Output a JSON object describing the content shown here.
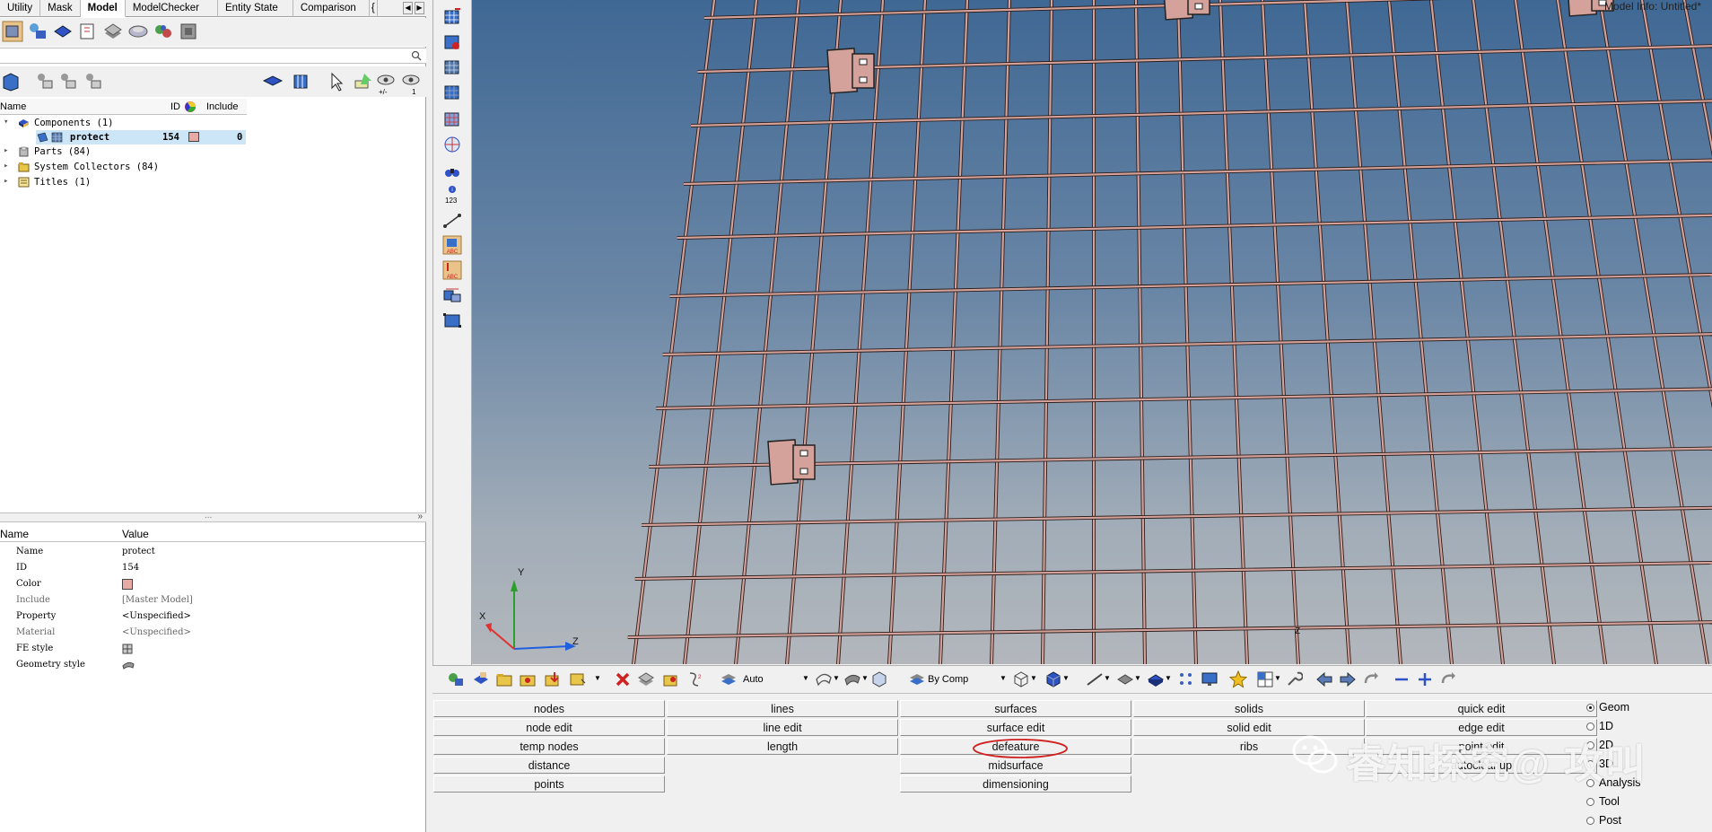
{
  "left_panel": {
    "tabs": [
      "Utility",
      "Mask",
      "Model",
      "ModelChecker",
      "Entity State",
      "Comparison",
      "{"
    ],
    "active_tab": "Model",
    "tab_scroll": {
      "left": "◀",
      "right": "▶"
    },
    "tree_header": {
      "name": "Name",
      "id": "ID",
      "include": "Include"
    },
    "tree": [
      {
        "label": "Components (1)",
        "icon": "components-icon"
      },
      {
        "label": "protect",
        "id": "154",
        "include": "0",
        "color": "#e8aaa4",
        "selected": true
      },
      {
        "label": "Parts (84)",
        "icon": "parts-icon"
      },
      {
        "label": "System Collectors (84)",
        "icon": "collectors-icon"
      },
      {
        "label": "Titles (1)",
        "icon": "titles-icon"
      }
    ],
    "splitter": {
      "dots": "...",
      "chevron": "»"
    },
    "props_header": {
      "name": "Name",
      "value": "Value"
    },
    "props": [
      {
        "key": "Name",
        "value": "protect"
      },
      {
        "key": "ID",
        "value": "154"
      },
      {
        "key": "Color",
        "value": "",
        "swatch": "#e8aaa4"
      },
      {
        "key": "Include",
        "value": "[Master Model]"
      },
      {
        "key": "Property",
        "value": "<Unspecified>"
      },
      {
        "key": "Material",
        "value": "<Unspecified>"
      },
      {
        "key": "FE style",
        "value": ""
      },
      {
        "key": "Geometry style",
        "value": ""
      }
    ],
    "toolbar2_labels": {
      "plus_minus": "+/-",
      "one": "1"
    }
  },
  "vertical_toolbar": {
    "info_label": "123"
  },
  "viewport": {
    "model_info": "Model Info: Untitled*",
    "triad": {
      "y": "Y",
      "x": "X",
      "z": "Z"
    },
    "small_triad_z": "Z",
    "background_top": "#3f6894",
    "background_bottom": "#b3b7bc",
    "mesh_color": "#d4a29a"
  },
  "bottom_toolbar": {
    "auto_label": "Auto",
    "bycomp_label": "By Comp"
  },
  "panel_menu": {
    "columns": [
      [
        "nodes",
        "node edit",
        "temp nodes",
        "distance",
        "points"
      ],
      [
        "lines",
        "line edit",
        "length"
      ],
      [
        "surfaces",
        "surface edit",
        "defeature",
        "midsurface",
        "dimensioning"
      ],
      [
        "solids",
        "solid edit",
        "ribs"
      ],
      [
        "quick edit",
        "edge edit",
        "point edit",
        "autocleanup"
      ]
    ],
    "modes": [
      "Geom",
      "1D",
      "2D",
      "3D",
      "Analysis",
      "Tool",
      "Post"
    ],
    "selected_mode": "Geom",
    "watermark": "睿知探究@ 攻叫"
  }
}
